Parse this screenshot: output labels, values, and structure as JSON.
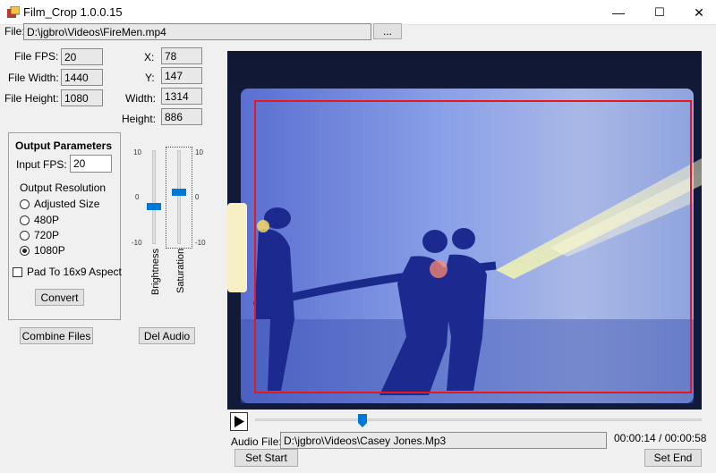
{
  "window": {
    "title": "Film_Crop 1.0.0.15",
    "minimize": "—",
    "maximize": "☐",
    "close": "✕"
  },
  "file": {
    "label": "File:",
    "path": "D:\\jgbro\\Videos\\FireMen.mp4",
    "browse_label": "..."
  },
  "info": {
    "fps_label": "File FPS:",
    "fps": "20",
    "width_label": "File Width:",
    "width": "1440",
    "height_label": "File Height:",
    "height": "1080"
  },
  "crop": {
    "x_label": "X:",
    "x": "78",
    "y_label": "Y:",
    "y": "147",
    "w_label": "Width:",
    "w": "1314",
    "h_label": "Height:",
    "h": "886"
  },
  "output": {
    "title": "Output Parameters",
    "input_fps_label": "Input FPS:",
    "input_fps": "20",
    "resolution_label": "Output Resolution",
    "options": [
      "Adjusted Size",
      "480P",
      "720P",
      "1080P"
    ],
    "selected": "1080P",
    "pad_label": "Pad To 16x9 Aspect",
    "convert_label": "Convert"
  },
  "sliders": {
    "brightness_label": "Brightness",
    "saturation_label": "Saturation",
    "tick_top": "10",
    "tick_mid": "0",
    "tick_bottom": "-10",
    "brightness_value": -2,
    "saturation_value": 1
  },
  "buttons": {
    "combine": "Combine Files",
    "del_audio": "Del Audio",
    "set_start": "Set Start",
    "set_end": "Set End"
  },
  "playback": {
    "position_fraction": 0.24,
    "time": "00:00:14 / 00:00:58"
  },
  "audio": {
    "label": "Audio File:",
    "path": "D:\\jgbro\\Videos\\Casey Jones.Mp3"
  },
  "colors": {
    "accent": "#0078d7",
    "crop_rect": "#e8161e"
  }
}
